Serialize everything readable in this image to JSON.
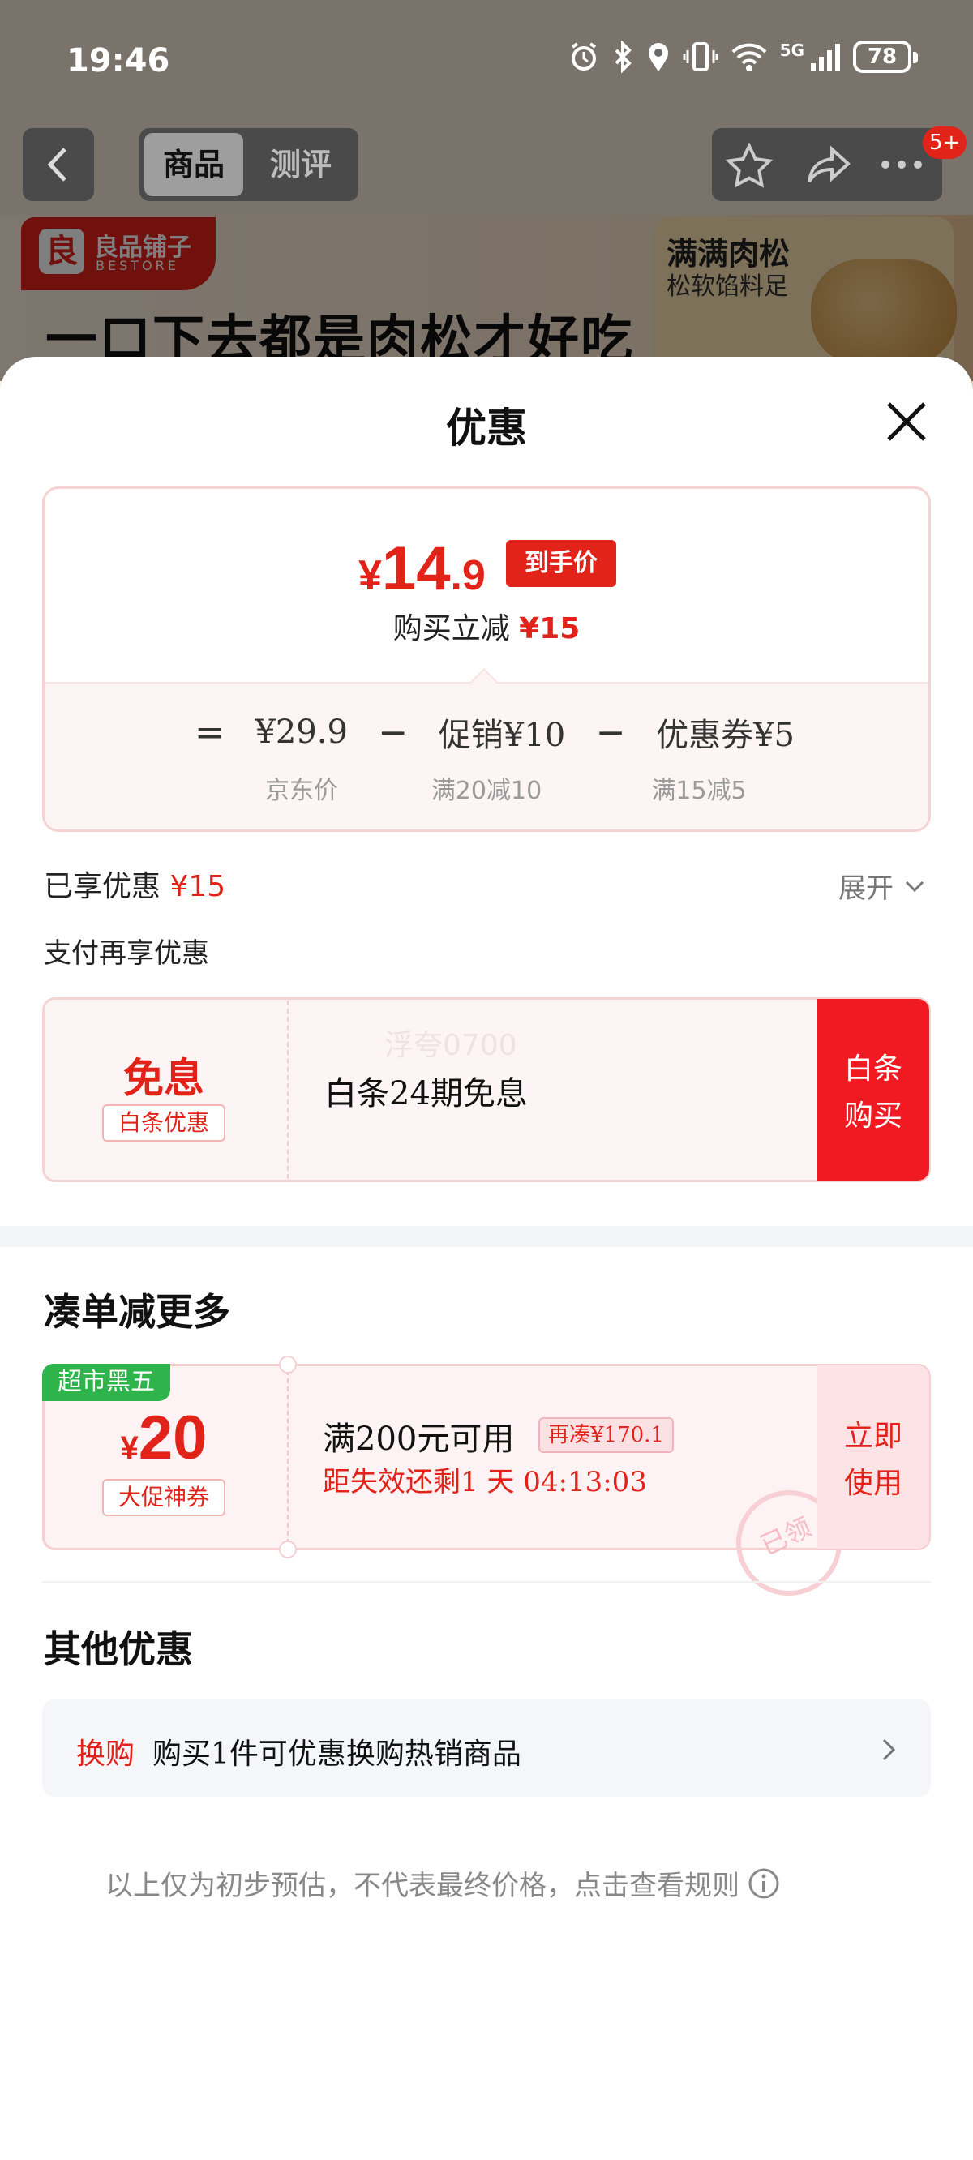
{
  "status_bar": {
    "time": "19:46",
    "network": "5G",
    "battery": "78"
  },
  "nav": {
    "tabs": [
      "商品",
      "测评"
    ],
    "badge": "5+"
  },
  "banner": {
    "brand_name": "良品铺子",
    "brand_sub": "BESTORE",
    "headline": "一口下去都是肉松才好吃",
    "side_title": "满满肉松",
    "side_sub": "松软馅料足"
  },
  "sheet": {
    "title": "优惠",
    "price": {
      "yen": "¥",
      "int": "14",
      "dec": ".9",
      "tag": "到手价"
    },
    "instant_cut": {
      "label": "购买立减",
      "amount": "¥15"
    },
    "formula": {
      "eq": "=",
      "minus": "−",
      "items": [
        {
          "value": "¥29.9",
          "note": "京东价"
        },
        {
          "value": "促销¥10",
          "note": "满20减10"
        },
        {
          "value": "优惠券¥5",
          "note": "满15减5"
        }
      ]
    },
    "enjoyed": {
      "label": "已享优惠",
      "amount": "¥15"
    },
    "expand": "展开",
    "pay_more": "支付再享优惠",
    "baitiao": {
      "free": "免息",
      "tag": "白条优惠",
      "desc": "白条24期免息",
      "btn_line1": "白条",
      "btn_line2": "购买",
      "watermark": "浮夸0700"
    },
    "more_section": {
      "title": "凑单减更多",
      "badge": "超市黑五",
      "yen": "¥",
      "amount": "20",
      "tag": "大促神券",
      "condition": "满200元可用",
      "add_more": "再凑¥170.1",
      "expire": "距失效还剩1 天 04:13:03",
      "stamp": "已领",
      "btn_line1": "立即",
      "btn_line2": "使用"
    },
    "other": {
      "title": "其他优惠",
      "label": "换购",
      "text": "购买1件可优惠换购热销商品"
    },
    "disclaimer": "以上仅为初步预估，不代表最终价格，点击查看规则"
  }
}
